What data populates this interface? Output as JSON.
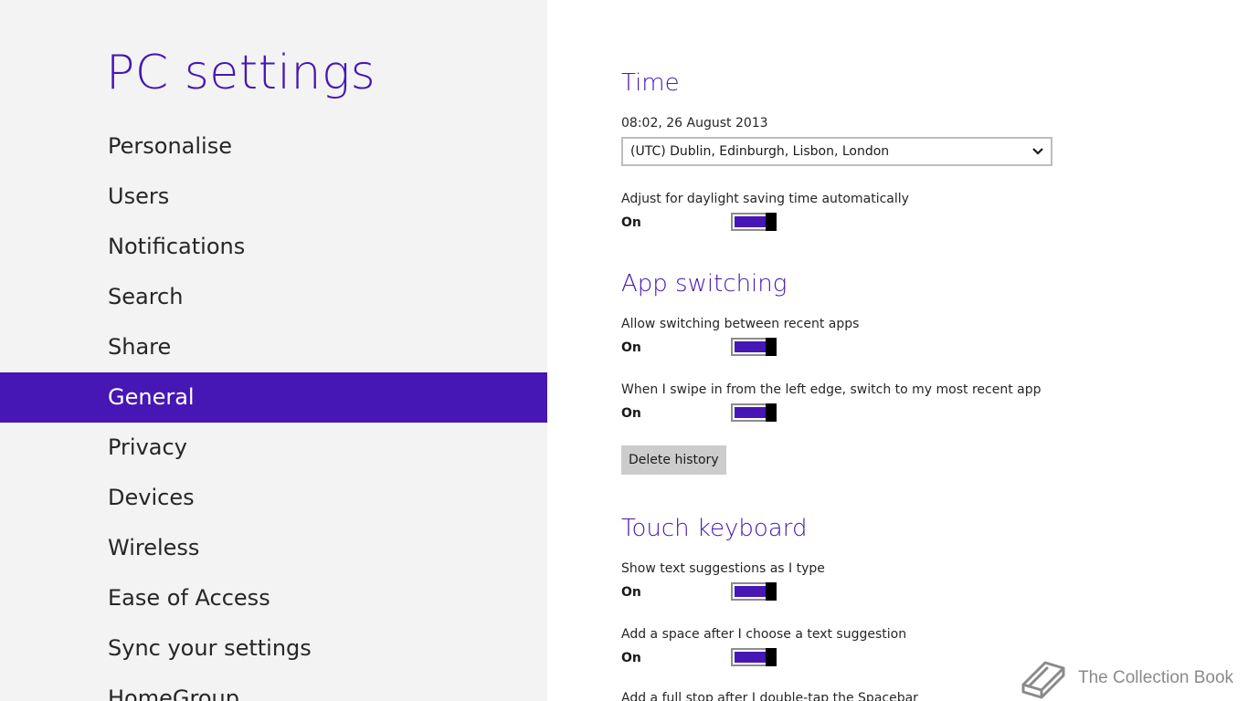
{
  "nav": {
    "title": "PC settings",
    "items": [
      {
        "label": "Personalise"
      },
      {
        "label": "Users"
      },
      {
        "label": "Notifications"
      },
      {
        "label": "Search"
      },
      {
        "label": "Share"
      },
      {
        "label": "General"
      },
      {
        "label": "Privacy"
      },
      {
        "label": "Devices"
      },
      {
        "label": "Wireless"
      },
      {
        "label": "Ease of Access"
      },
      {
        "label": "Sync your settings"
      },
      {
        "label": "HomeGroup"
      }
    ],
    "selected": "General"
  },
  "time": {
    "heading": "Time",
    "current": "08:02, 26 August 2013",
    "timezone": "(UTC) Dublin, Edinburgh, Lisbon, London",
    "daylight_label": "Adjust for daylight saving time automatically",
    "daylight_state": "On"
  },
  "app_switching": {
    "heading": "App switching",
    "allow_label": "Allow switching between recent apps",
    "allow_state": "On",
    "swipe_label": "When I swipe in from the left edge, switch to my most recent app",
    "swipe_state": "On",
    "delete_button": "Delete history"
  },
  "touch_keyboard": {
    "heading": "Touch keyboard",
    "suggestions_label": "Show text suggestions as I type",
    "suggestions_state": "On",
    "space_label": "Add a space after I choose a text suggestion",
    "space_state": "On",
    "fullstop_label": "Add a full stop after I double-tap the Spacebar"
  },
  "watermark": {
    "text": "The Collection Book"
  },
  "colors": {
    "accent": "#4617b4",
    "nav_background": "#f3f3f3",
    "toggle_thumb": "#000000",
    "button_background": "#cccccc"
  }
}
